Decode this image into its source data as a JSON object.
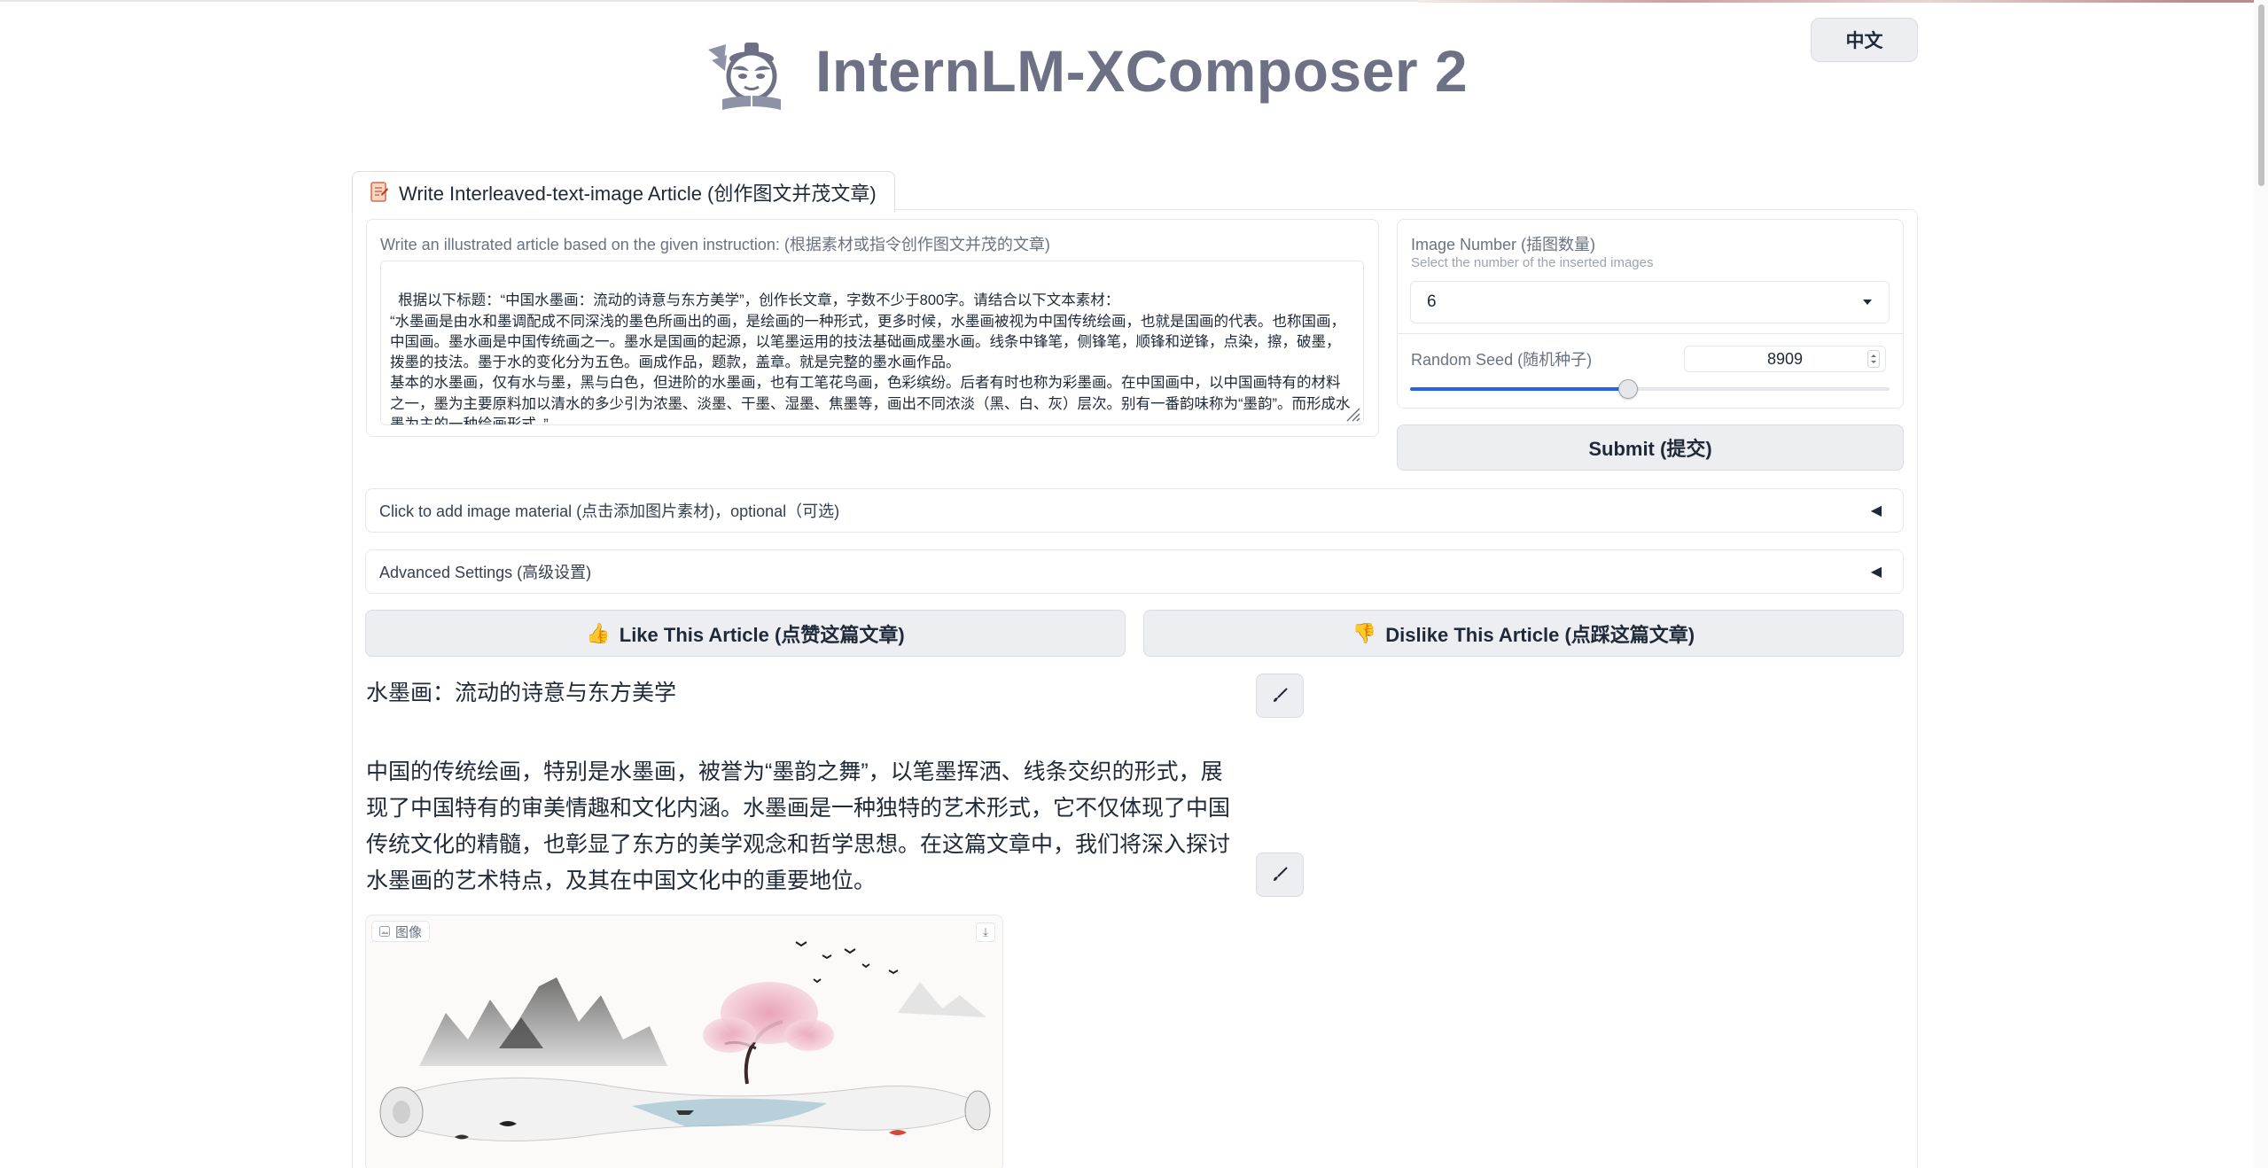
{
  "header": {
    "title": "InternLM-XComposer 2",
    "lang_button": "中文"
  },
  "tab": {
    "label": "Write Interleaved-text-image Article (创作图文并茂文章)"
  },
  "instruction": {
    "label": "Write an illustrated article based on the given instruction: (根据素材或指令创作图文并茂的文章)",
    "value": "根据以下标题：“中国水墨画：流动的诗意与东方美学”，创作长文章，字数不少于800字。请结合以下文本素材：\n“水墨画是由水和墨调配成不同深浅的墨色所画出的画，是绘画的一种形式，更多时候，水墨画被视为中国传统绘画，也就是国画的代表。也称国画，中国画。墨水画是中国传统画之一。墨水是国画的起源，以笔墨运用的技法基础画成墨水画。线条中锋笔，侧锋笔，顺锋和逆锋，点染，擦，破墨，拨墨的技法。墨于水的变化分为五色。画成作品，题款，盖章。就是完整的墨水画作品。\n基本的水墨画，仅有水与墨，黑与白色，但进阶的水墨画，也有工笔花鸟画，色彩缤纷。后者有时也称为彩墨画。在中国画中，以中国画特有的材料之一，墨为主要原料加以清水的多少引为浓墨、淡墨、干墨、湿墨、焦墨等，画出不同浓淡（黑、白、灰）层次。别有一番韵味称为“墨韵”。而形成水墨为主的一种绘画形式。”"
  },
  "image_number": {
    "label": "Image Number (插图数量)",
    "info": "Select the number of the inserted images",
    "value": "6"
  },
  "random_seed": {
    "label": "Random Seed (随机种子)",
    "value": "8909",
    "slider_fraction": 0.455
  },
  "submit_label": "Submit (提交)",
  "image_material_label": "Click to add image material (点击添加图片素材)，optional（可选)",
  "advanced_label": "Advanced Settings (高级设置)",
  "like_label": "Like This Article (点赞这篇文章)",
  "dislike_label": "Dislike This Article (点踩这篇文章)",
  "like_emoji": "👍",
  "dislike_emoji": "👎",
  "article": {
    "heading": "水墨画：流动的诗意与东方美学",
    "paragraph": "中国的传统绘画，特别是水墨画，被誉为“墨韵之舞”，以笔墨挥洒、线条交织的形式，展现了中国特有的审美情趣和文化内涵。水墨画是一种独特的艺术形式，它不仅体现了中国传统文化的精髓，也彰显了东方的美学观念和哲学思想。在这篇文章中，我们将深入探讨水墨画的艺术特点，及其在中国文化中的重要地位。",
    "image_label": "图像"
  },
  "icons": {
    "logo": "scholar-logo-icon",
    "tab": "document-icon",
    "edit": "brush-icon",
    "download": "download-icon",
    "caret": "triangle-left-icon"
  },
  "colors": {
    "accent": "#2563eb",
    "title": "#6e7186",
    "button_bg": "#eceef2"
  }
}
